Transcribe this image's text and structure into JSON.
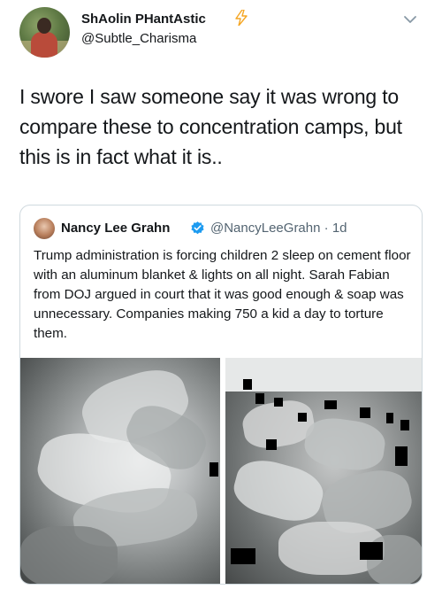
{
  "author": {
    "display_name": "ShAolin PHantAstic",
    "handle": "@Subtle_Charisma",
    "badge_icon": "lightning-bolt-icon",
    "badge_color": "#f5a623"
  },
  "tweet": {
    "text": "I swore I saw someone say it was wrong to compare these to concentration camps, but this is in fact what it is.."
  },
  "quoted_tweet": {
    "display_name": "Nancy Lee Grahn",
    "verified_color": "#1d9bf0",
    "handle": "@NancyLeeGrahn",
    "separator": "·",
    "time": "1d",
    "text": "Trump administration is forcing children 2 sleep on cement floor with an aluminum blanket & lights on all night. Sarah Fabian from DOJ argued in court that it was good enough & soap was unnecessary. Companies making 750 a kid a day to torture them."
  },
  "icons": {
    "menu": "chevron-down-icon",
    "verified": "verified-badge-icon"
  }
}
